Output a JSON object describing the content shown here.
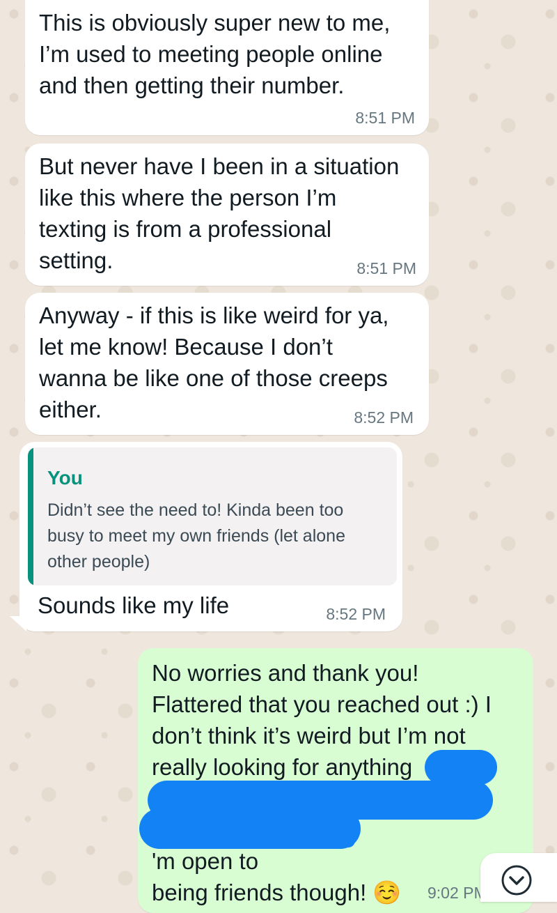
{
  "chat": {
    "messages": [
      {
        "direction": "incoming",
        "text": "This is obviously super new to me,\nI’m used to meeting people online\nand then getting their number.",
        "time": "8:51 PM"
      },
      {
        "direction": "incoming",
        "text": "But never have I been in a situation\nlike this where the person I’m\ntexting is from a professional\nsetting.",
        "time": "8:51 PM"
      },
      {
        "direction": "incoming",
        "text": "Anyway - if this is like weird for ya,\nlet me know! Because I don’t\nwanna be like one of those creeps\neither.",
        "time": "8:52 PM"
      },
      {
        "direction": "incoming",
        "quote": {
          "author": "You",
          "text": "Didn’t see the need to! Kinda been too\nbusy to meet my own friends (let alone\nother people)"
        },
        "text": "Sounds like my life",
        "time": "8:52 PM"
      },
      {
        "direction": "outgoing",
        "text": "No worries and thank you!\nFlattered that you reached out :) I\ndon’t think it’s weird but I’m not\nreally looking for anything\n\n\n'm open to\nbeing friends though! ☺️",
        "time": "9:02 PM",
        "redacted": true
      }
    ]
  },
  "scroll_button": {
    "icon": "chevron-down-icon"
  },
  "colors": {
    "incoming_bubble": "#ffffff",
    "outgoing_bubble": "#d9fdd3",
    "quote_accent": "#06927d",
    "redaction": "#1282f5",
    "background": "#efe7dd"
  }
}
